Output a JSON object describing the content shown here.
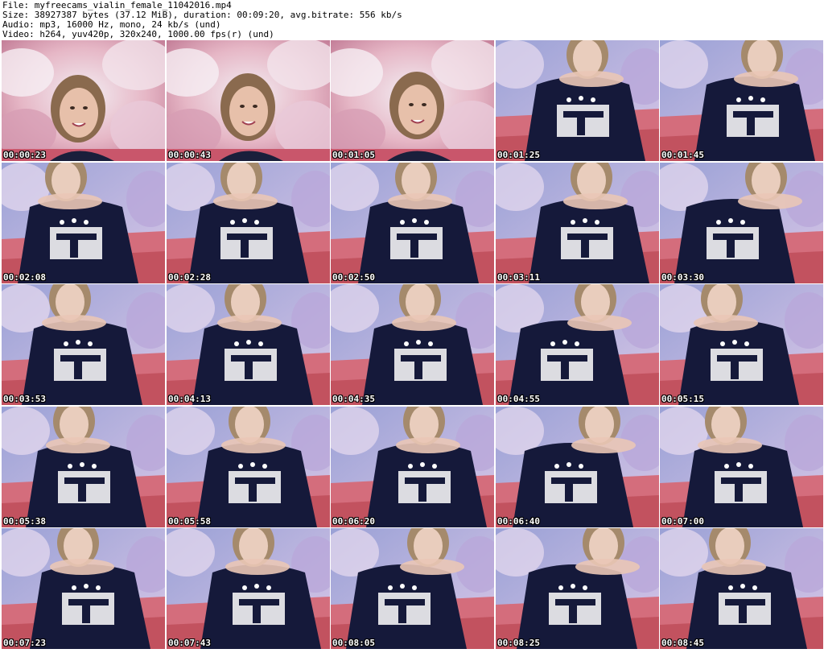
{
  "header": {
    "file": "File: myfreecams_vialin_female_11042016.mp4",
    "size": "Size: 38927387 bytes (37.12 MiB), duration: 00:09:20, avg.bitrate: 556 kb/s",
    "audio": "Audio: mp3, 16000 Hz, mono, 24 kb/s (und)",
    "video": "Video: h264, yuv420p, 320x240, 1000.00 fps(r) (und)"
  },
  "thumbnails": [
    {
      "timestamp": "00:00:23"
    },
    {
      "timestamp": "00:00:43"
    },
    {
      "timestamp": "00:01:05"
    },
    {
      "timestamp": "00:01:25"
    },
    {
      "timestamp": "00:01:45"
    },
    {
      "timestamp": "00:02:08"
    },
    {
      "timestamp": "00:02:28"
    },
    {
      "timestamp": "00:02:50"
    },
    {
      "timestamp": "00:03:11"
    },
    {
      "timestamp": "00:03:30"
    },
    {
      "timestamp": "00:03:53"
    },
    {
      "timestamp": "00:04:13"
    },
    {
      "timestamp": "00:04:35"
    },
    {
      "timestamp": "00:04:55"
    },
    {
      "timestamp": "00:05:15"
    },
    {
      "timestamp": "00:05:38"
    },
    {
      "timestamp": "00:05:58"
    },
    {
      "timestamp": "00:06:20"
    },
    {
      "timestamp": "00:06:40"
    },
    {
      "timestamp": "00:07:00"
    },
    {
      "timestamp": "00:07:23"
    },
    {
      "timestamp": "00:07:43"
    },
    {
      "timestamp": "00:08:05"
    },
    {
      "timestamp": "00:08:25"
    },
    {
      "timestamp": "00:08:45"
    }
  ]
}
